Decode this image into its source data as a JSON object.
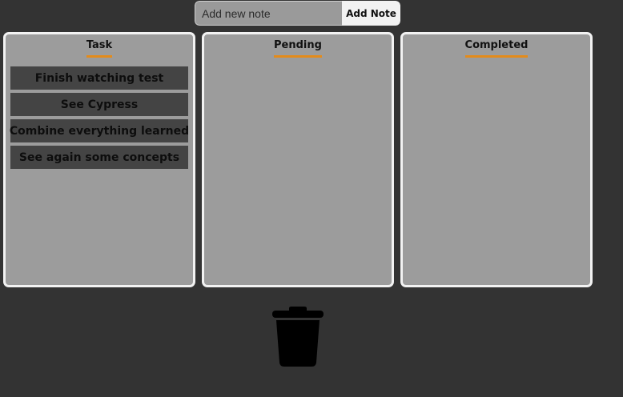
{
  "header": {
    "input_placeholder": "Add new note",
    "add_button_label": "Add Note"
  },
  "columns": [
    {
      "title": "Task",
      "cards": [
        "Finish watching test",
        "See Cypress",
        "Combine everything learned",
        "See again some concepts"
      ]
    },
    {
      "title": "Pending",
      "cards": []
    },
    {
      "title": "Completed",
      "cards": []
    }
  ],
  "colors": {
    "background": "#333333",
    "column_fill": "#9c9c9c",
    "card_fill": "#444444",
    "accent_underline": "#e38b1b"
  },
  "icons": {
    "trash": "trash-icon"
  }
}
